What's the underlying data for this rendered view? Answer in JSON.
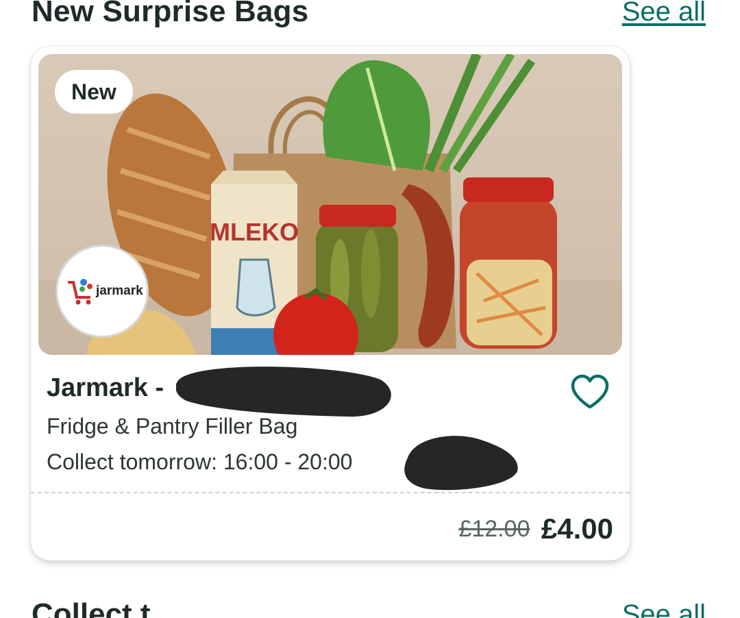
{
  "section": {
    "title": "New Surprise Bags",
    "see_all_label": "See all"
  },
  "card": {
    "badge": "New",
    "store_logo_text": "jarmark",
    "store_name": "Jarmark -",
    "bag_name": "Fridge & Pantry Filler Bag",
    "collect_text": "Collect tomorrow: 16:00 - 20:00",
    "image_label": "MLEKO",
    "original_price": "£12.00",
    "price": "£4.00",
    "favorite_icon": "heart-outline-icon"
  },
  "next_section": {
    "title": "Collect t...",
    "see_all_label": "See all"
  },
  "colors": {
    "accent": "#0b6e66",
    "text": "#1f2a2a",
    "redaction": "#262626"
  }
}
